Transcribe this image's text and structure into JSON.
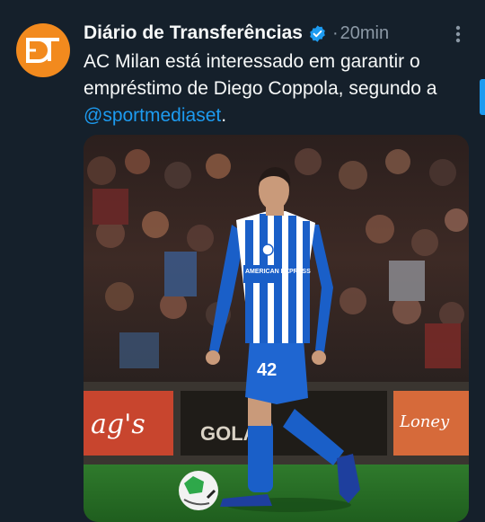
{
  "account": {
    "display_name": "Diário de Transferências",
    "verified": true,
    "separator": "·",
    "time_ago": "20min",
    "avatar_initials": "DT",
    "avatar_color": "#f28a1e"
  },
  "tweet": {
    "text_before": "AC Milan está interessado em garantir o empréstimo de Diego Coppola, segundo a ",
    "mention": "@sportmediaset",
    "text_after": "."
  },
  "media": {
    "type": "photo",
    "shirt_sponsor": "AMERICAN EXPRESS",
    "shirt_number": "42",
    "board_texts": [
      "ag's",
      "GOLA",
      "Loney"
    ]
  },
  "icons": {
    "verified": "verified-badge-icon",
    "more": "more-options-icon"
  },
  "colors": {
    "background": "#15202b",
    "link": "#1d9bf0",
    "muted": "#8b98a5",
    "kit_blue": "#1a5fc8"
  }
}
